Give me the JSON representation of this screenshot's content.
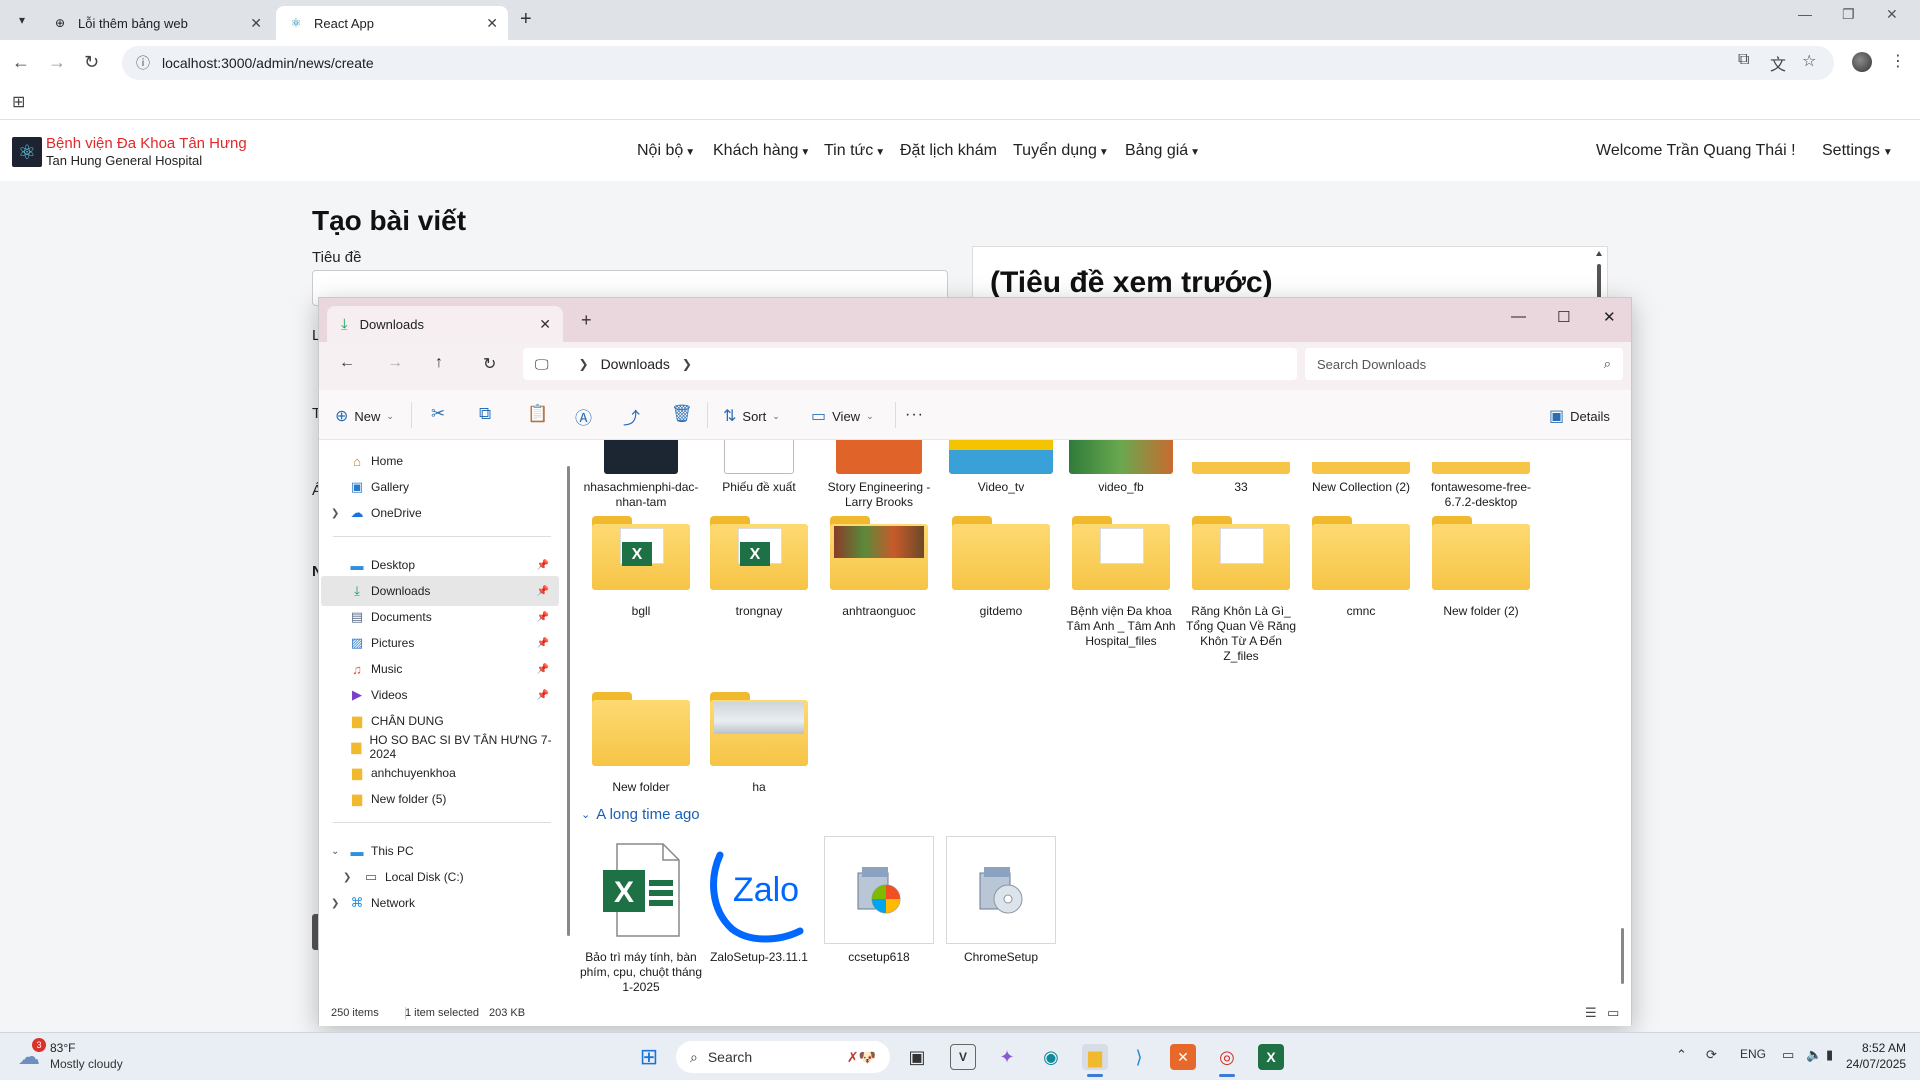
{
  "browser": {
    "tabs": [
      {
        "title": "Lỗi thêm bảng web",
        "active": false
      },
      {
        "title": "React App",
        "active": true
      }
    ],
    "url": "localhost:3000/admin/news/create"
  },
  "site": {
    "brand_vi": "Bệnh viện Đa Khoa Tân Hưng",
    "brand_en": "Tan Hung General Hospital",
    "menu": [
      "Nội bộ",
      "Khách hàng",
      "Tin tức",
      "Đặt lịch khám",
      "Tuyển dụng",
      "Bảng giá"
    ],
    "welcome": "Welcome Trần Quang Thái !",
    "settings": "Settings"
  },
  "form": {
    "page_title": "Tạo bài viết",
    "title_label": "Tiêu đề",
    "preview_title": "(Tiêu đề xem trước)",
    "hidden_label_fragments": [
      "L",
      "T",
      "Á",
      "N"
    ]
  },
  "explorer": {
    "tab_title": "Downloads",
    "breadcrumb": "Downloads",
    "search_placeholder": "Search Downloads",
    "commands": {
      "new": "New",
      "sort": "Sort",
      "view": "View",
      "more": "···",
      "details": "Details"
    },
    "sidebar": [
      {
        "label": "Home",
        "icon": "home-icon"
      },
      {
        "label": "Gallery",
        "icon": "gallery-icon"
      },
      {
        "label": "OneDrive",
        "icon": "cloud-icon"
      },
      {
        "label": "Desktop",
        "icon": "desktop-icon"
      },
      {
        "label": "Downloads",
        "icon": "download-icon"
      },
      {
        "label": "Documents",
        "icon": "document-icon"
      },
      {
        "label": "Pictures",
        "icon": "pictures-icon"
      },
      {
        "label": "Music",
        "icon": "music-icon"
      },
      {
        "label": "Videos",
        "icon": "videos-icon"
      },
      {
        "label": "CHÂN DUNG",
        "icon": "folder-icon"
      },
      {
        "label": "HO SO BAC SI BV TÂN HƯNG 7-2024",
        "icon": "folder-icon"
      },
      {
        "label": "anhchuyenkhoa",
        "icon": "folder-icon"
      },
      {
        "label": "New folder (5)",
        "icon": "folder-icon"
      },
      {
        "label": "This PC",
        "icon": "pc-icon"
      },
      {
        "label": "Local Disk (C:)",
        "icon": "disk-icon"
      },
      {
        "label": "Network",
        "icon": "network-icon"
      }
    ],
    "top_row": [
      "nhasachmienphi-dac-nhan-tam",
      "Phiếu đề xuất",
      "Story Engineering - Larry Brooks",
      "Video_tv",
      "video_fb",
      "33",
      "New Collection (2)",
      "fontawesome-free-6.7.2-desktop"
    ],
    "folders_row1": [
      "bgll",
      "trongnay",
      "anhtraonguoc",
      "gitdemo",
      "Bệnh viện Đa khoa Tâm Anh _ Tâm Anh Hospital_files",
      "Răng Khôn Là Gì_ Tổng Quan Về Răng Khôn Từ A Đến Z_files",
      "cmnc",
      "New folder (2)"
    ],
    "folders_row2": [
      "New folder",
      "ha"
    ],
    "group_header": "A long time ago",
    "old_files": [
      "Bảo trì máy tính, bàn phím, cpu, chuột tháng 1-2025",
      "ZaloSetup-23.11.1",
      "ccsetup618",
      "ChromeSetup"
    ],
    "status": {
      "count": "250 items",
      "selection": "1 item selected",
      "size": "203 KB"
    }
  },
  "taskbar": {
    "weather_temp": "83°F",
    "weather_desc": "Mostly cloudy",
    "weather_badge": "3",
    "search": "Search",
    "lang": "ENG",
    "time": "8:52 AM",
    "date": "24/07/2025"
  },
  "colors": {
    "brand_red": "#e0292a",
    "explorer_title": "#ead7de",
    "folder": "#f6c446",
    "link_blue": "#1a5fb4"
  }
}
